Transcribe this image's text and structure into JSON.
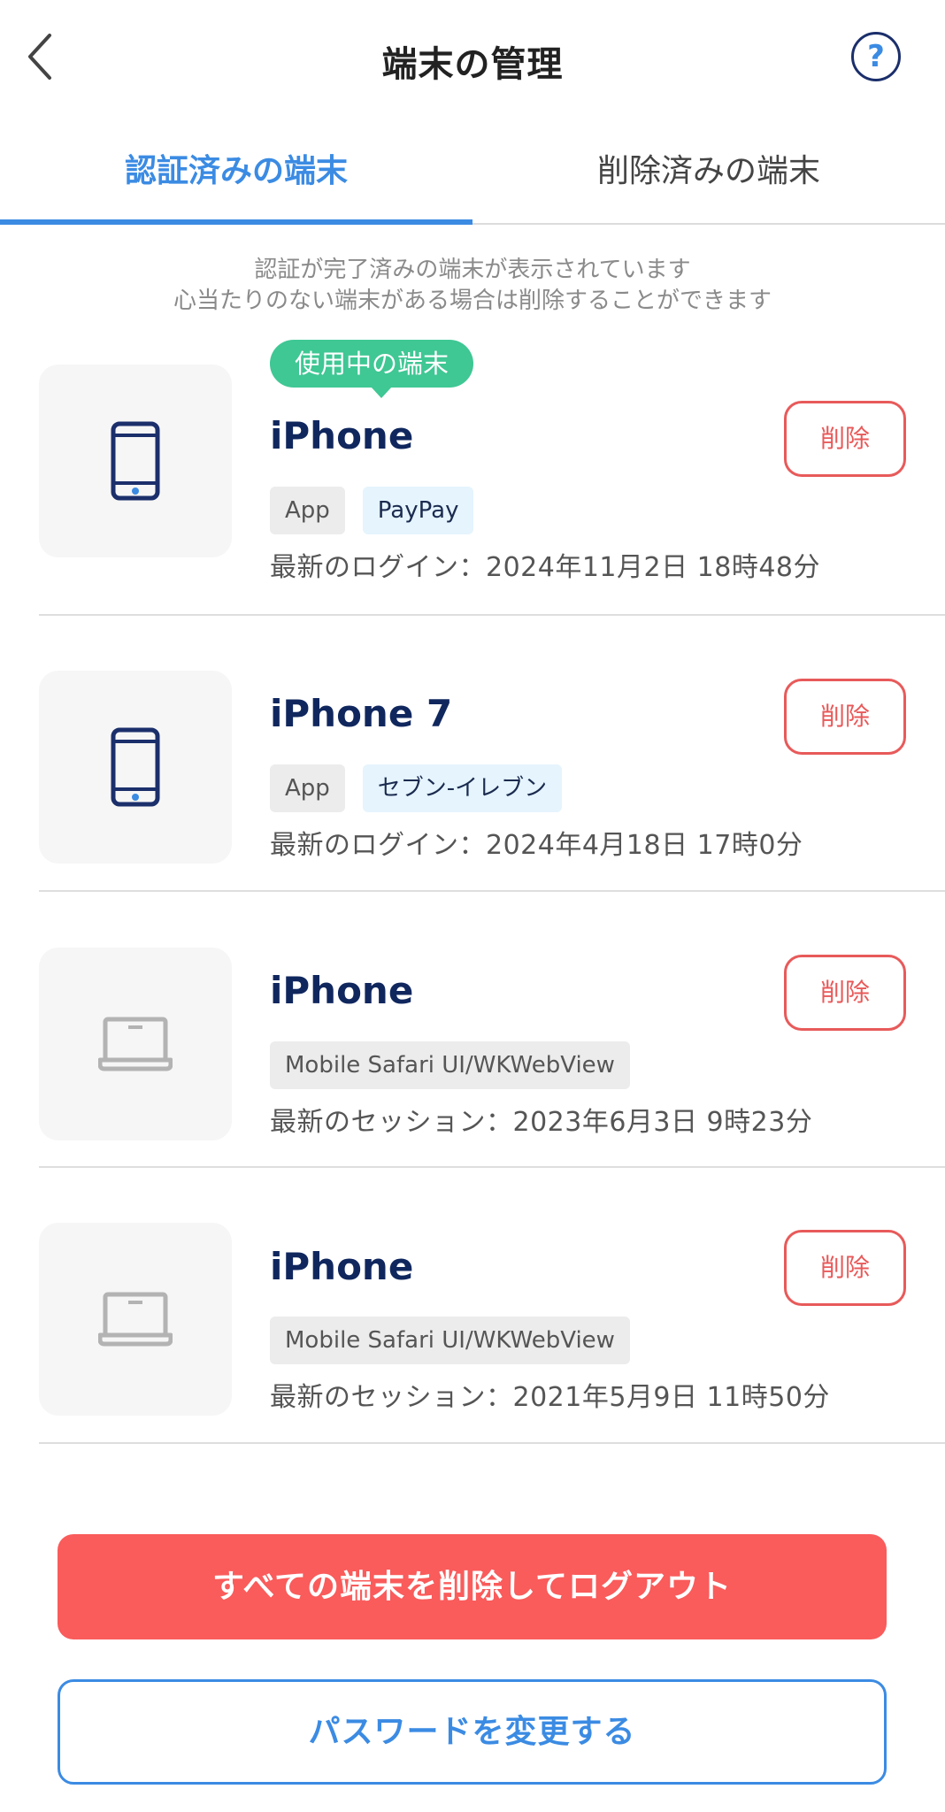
{
  "header": {
    "title": "端末の管理",
    "help_label": "?"
  },
  "tabs": [
    {
      "label": "認証済みの端末",
      "active": true
    },
    {
      "label": "削除済みの端末",
      "active": false
    }
  ],
  "note": {
    "line1": "認証が完了済みの端末が表示されています",
    "line2": "心当たりのない端末がある場合は削除することができます"
  },
  "devices": [
    {
      "icon": "phone-icon",
      "current_badge": "使用中の端末",
      "name": "iPhone",
      "delete_label": "削除",
      "tags": [
        "App",
        "PayPay"
      ],
      "login": "最新のログイン：2024年11月2日 18時48分"
    },
    {
      "icon": "phone-icon",
      "name": "iPhone 7",
      "delete_label": "削除",
      "tags": [
        "App",
        "セブン-イレブン"
      ],
      "login": "最新のログイン：2024年4月18日 17時0分"
    },
    {
      "icon": "laptop-icon",
      "name": "iPhone",
      "delete_label": "削除",
      "tags": [
        "Mobile Safari UI/WKWebView"
      ],
      "login": "最新のセッション：2023年6月3日 9時23分"
    },
    {
      "icon": "laptop-icon",
      "name": "iPhone",
      "delete_label": "削除",
      "tags": [
        "Mobile Safari UI/WKWebView"
      ],
      "login": "最新のセッション：2021年5月9日 11時50分"
    }
  ],
  "actions": {
    "delete_all_logout": "すべての端末を削除してログアウト",
    "change_password": "パスワードを変更する"
  },
  "colors": {
    "accent_blue": "#3b8be3",
    "navy": "#10275e",
    "danger_red": "#fa5b5b",
    "current_green": "#3fc794"
  }
}
